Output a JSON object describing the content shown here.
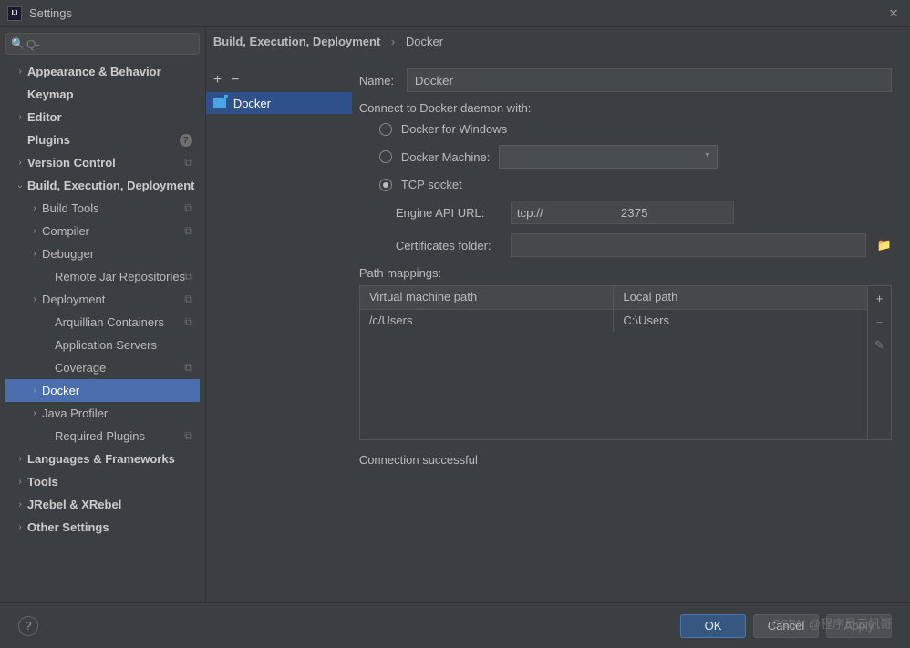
{
  "window": {
    "title": "Settings"
  },
  "search": {
    "placeholder": "Q-"
  },
  "sidebar": {
    "items": [
      {
        "label": "Appearance & Behavior",
        "chev": "closed",
        "indent": 1,
        "bold": true
      },
      {
        "label": "Keymap",
        "chev": "none",
        "indent": 1,
        "bold": true
      },
      {
        "label": "Editor",
        "chev": "closed",
        "indent": 1,
        "bold": true
      },
      {
        "label": "Plugins",
        "chev": "none",
        "indent": 1,
        "bold": true,
        "counter": "7"
      },
      {
        "label": "Version Control",
        "chev": "closed",
        "indent": 1,
        "bold": true,
        "badge": "⧉"
      },
      {
        "label": "Build, Execution, Deployment",
        "chev": "open",
        "indent": 1,
        "bold": true
      },
      {
        "label": "Build Tools",
        "chev": "closed",
        "indent": 2,
        "badge": "⧉"
      },
      {
        "label": "Compiler",
        "chev": "closed",
        "indent": 2,
        "badge": "⧉"
      },
      {
        "label": "Debugger",
        "chev": "closed",
        "indent": 2
      },
      {
        "label": "Remote Jar Repositories",
        "chev": "none",
        "indent": 3,
        "badge": "⧉"
      },
      {
        "label": "Deployment",
        "chev": "closed",
        "indent": 2,
        "badge": "⧉"
      },
      {
        "label": "Arquillian Containers",
        "chev": "none",
        "indent": 3,
        "badge": "⧉"
      },
      {
        "label": "Application Servers",
        "chev": "none",
        "indent": 3
      },
      {
        "label": "Coverage",
        "chev": "none",
        "indent": 3,
        "badge": "⧉"
      },
      {
        "label": "Docker",
        "chev": "closed",
        "indent": 2,
        "selected": true
      },
      {
        "label": "Java Profiler",
        "chev": "closed",
        "indent": 2
      },
      {
        "label": "Required Plugins",
        "chev": "none",
        "indent": 3,
        "badge": "⧉"
      },
      {
        "label": "Languages & Frameworks",
        "chev": "closed",
        "indent": 1,
        "bold": true
      },
      {
        "label": "Tools",
        "chev": "closed",
        "indent": 1,
        "bold": true
      },
      {
        "label": "JRebel & XRebel",
        "chev": "closed",
        "indent": 1,
        "bold": true
      },
      {
        "label": "Other Settings",
        "chev": "closed",
        "indent": 1,
        "bold": true
      }
    ]
  },
  "breadcrumb": {
    "parent": "Build, Execution, Deployment",
    "current": "Docker"
  },
  "middle": {
    "item": "Docker"
  },
  "form": {
    "name_label": "Name:",
    "name_value": "Docker",
    "connect_label": "Connect to Docker daemon with:",
    "radios": {
      "windows": "Docker for Windows",
      "machine": "Docker Machine:",
      "tcp": "TCP socket"
    },
    "engine_label": "Engine API URL:",
    "engine_value": "tcp://                       2375",
    "cert_label": "Certificates folder:",
    "cert_value": "",
    "mappings_label": "Path mappings:",
    "mappings_headers": {
      "vm": "Virtual machine path",
      "local": "Local path"
    },
    "mappings_rows": [
      {
        "vm": "/c/Users",
        "local": "C:\\Users"
      }
    ],
    "status": "Connection successful"
  },
  "buttons": {
    "ok": "OK",
    "cancel": "Cancel",
    "apply": "Apply"
  },
  "watermark": "CSDN @程序员云帆哥"
}
